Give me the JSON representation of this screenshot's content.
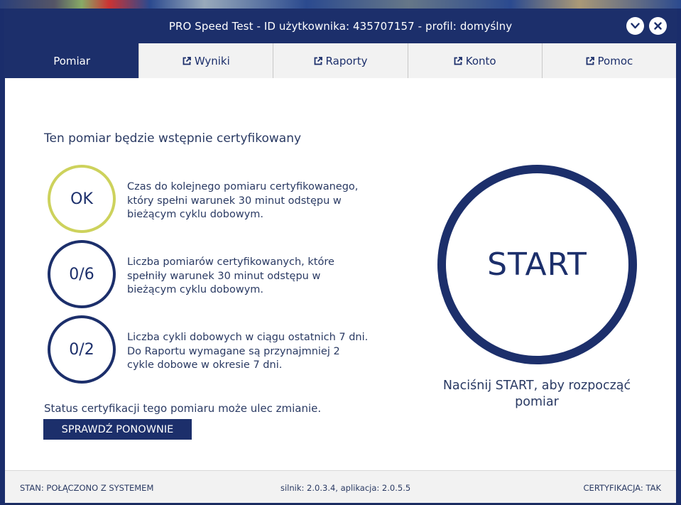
{
  "window": {
    "title": "PRO Speed Test - ID użytkownika: 435707157 - profil: domyślny"
  },
  "tabs": [
    {
      "label": "Pomiar",
      "active": true
    },
    {
      "label": "Wyniki",
      "icon": "external-link-icon"
    },
    {
      "label": "Raporty",
      "icon": "external-link-icon"
    },
    {
      "label": "Konto",
      "icon": "external-link-icon"
    },
    {
      "label": "Pomoc",
      "icon": "external-link-icon"
    }
  ],
  "main": {
    "headline": "Ten pomiar będzie wstępnie certyfikowany",
    "criteria": [
      {
        "value": "OK",
        "text": "Czas do kolejnego pomiaru certyfikowanego, który spełni warunek 30 minut odstępu w bieżącym cyklu dobowym."
      },
      {
        "value": "0/6",
        "text": "Liczba pomiarów certyfikowanych, które spełniły warunek 30 minut odstępu w bieżącym cyklu dobowym."
      },
      {
        "value": "0/2",
        "text": "Liczba cykli dobowych w ciągu ostatnich 7 dni. Do Raportu wymagane są przynajmniej 2 cykle dobowe w okresie 7 dni."
      }
    ],
    "status_note": "Status certyfikacji tego pomiaru może ulec zmianie.",
    "recheck_label": "SPRAWDŹ PONOWNIE",
    "start_label": "START",
    "start_hint": "Naciśnij START, aby rozpocząć pomiar"
  },
  "footer": {
    "status": "STAN: POŁĄCZONO Z SYSTEMEM",
    "versions": "silnik: 2.0.3.4, aplikacja: 2.0.5.5",
    "certification": "CERTYFIKACJA: TAK"
  },
  "colors": {
    "primary": "#1c2f6b",
    "ok_ring": "#cdd25c",
    "tab_inactive_bg": "#f2f2f2"
  }
}
